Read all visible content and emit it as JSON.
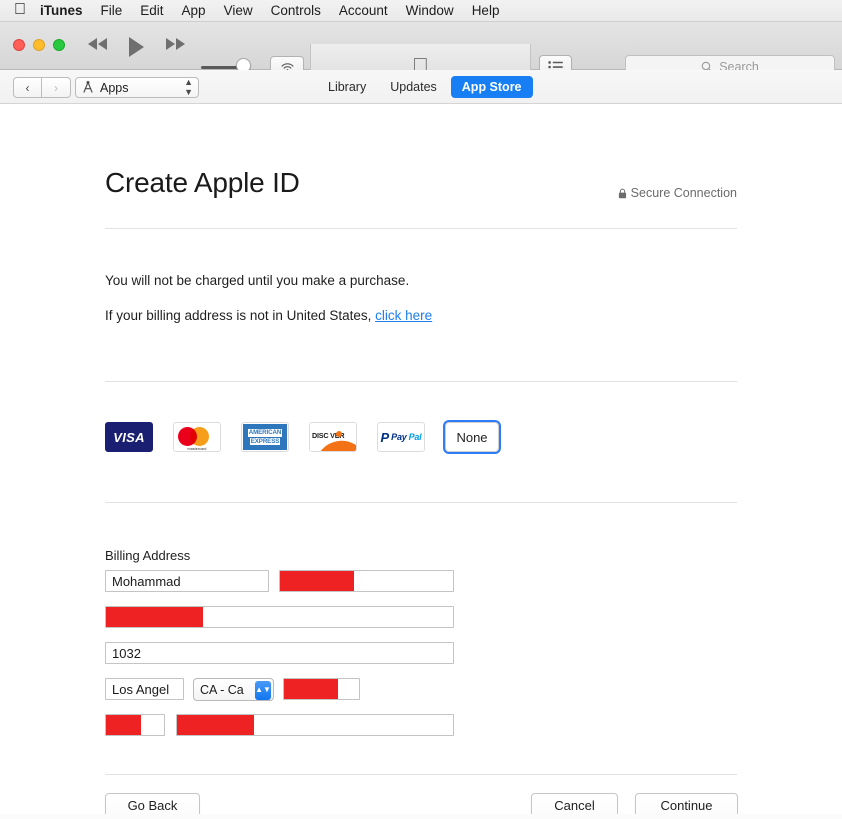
{
  "menubar": {
    "apple_icon": "apple-logo-icon",
    "items": [
      "iTunes",
      "File",
      "Edit",
      "App",
      "View",
      "Controls",
      "Account",
      "Window",
      "Help"
    ]
  },
  "toolbar": {
    "traffic_lights": [
      "close",
      "minimize",
      "zoom"
    ],
    "prev_icon": "rewind-icon",
    "play_icon": "play-icon",
    "next_icon": "fast-forward-icon",
    "volume_icon": "volume-slider",
    "airplay_icon": "airplay-icon",
    "lcd_icon": "apple-logo-icon",
    "list_icon": "list-view-icon",
    "search": {
      "icon": "search-icon",
      "placeholder": "Search",
      "value": ""
    }
  },
  "navbar": {
    "back_label": "‹",
    "forward_label": "›",
    "media_picker": {
      "icon": "apps-icon",
      "label": "Apps",
      "chevron": "chevron-updown-icon"
    },
    "tabs": [
      {
        "label": "Library",
        "active": false
      },
      {
        "label": "Updates",
        "active": false
      },
      {
        "label": "App Store",
        "active": true
      }
    ],
    "accent": "#177ef4"
  },
  "page": {
    "title": "Create Apple ID",
    "secure": {
      "icon": "lock-icon",
      "label": "Secure Connection"
    },
    "paragraph_1": "You will not be charged until you make a purchase.",
    "paragraph_2_prefix": "If your billing address is not in United States, ",
    "paragraph_2_link": "click here",
    "link_color": "#1d7ef0"
  },
  "payment_methods": [
    {
      "name": "visa",
      "label": "VISA",
      "selected": false
    },
    {
      "name": "mastercard",
      "label": "mastercard",
      "selected": false
    },
    {
      "name": "amex",
      "label_line1": "AMERICAN",
      "label_line2": "EXPRESS",
      "selected": false
    },
    {
      "name": "discover",
      "label": "DISC VER",
      "selected": false
    },
    {
      "name": "paypal",
      "label_p": "P",
      "label_pay": "Pay",
      "label_pal": "Pal",
      "selected": false
    },
    {
      "name": "none",
      "label": "None",
      "selected": true
    }
  ],
  "form": {
    "section_label": "Billing Address",
    "fields": [
      {
        "name": "first-name",
        "value": "Mohammad",
        "redacted": false,
        "redact_pct": 0
      },
      {
        "name": "last-name",
        "value": "",
        "redacted": true,
        "redact_pct": 43
      },
      {
        "name": "street-1",
        "value": "",
        "redacted": true,
        "redact_pct": 28
      },
      {
        "name": "street-2",
        "value": "1032",
        "redacted": false,
        "redact_pct": 0
      },
      {
        "name": "city",
        "value": "Los Angel",
        "redacted": false,
        "redact_pct": 0
      },
      {
        "name": "zip",
        "value": "",
        "redacted": true,
        "redact_pct": 72
      },
      {
        "name": "phone-area",
        "value": "",
        "redacted": true,
        "redact_pct": 60
      },
      {
        "name": "phone",
        "value": "",
        "redacted": true,
        "redact_pct": 28
      }
    ],
    "state_select": {
      "value": "CA - Ca",
      "chevron": "chevron-updown-icon"
    }
  },
  "actions": {
    "go_back": "Go Back",
    "cancel": "Cancel",
    "continue": "Continue"
  },
  "colors": {
    "redaction": "#ee2222",
    "accent_blue": "#177ef4",
    "visa_navy": "#1a1f71",
    "amex_blue": "#2e77bc",
    "discover_orange": "#f47216",
    "paypal_dark": "#003087",
    "paypal_light": "#009cde"
  }
}
